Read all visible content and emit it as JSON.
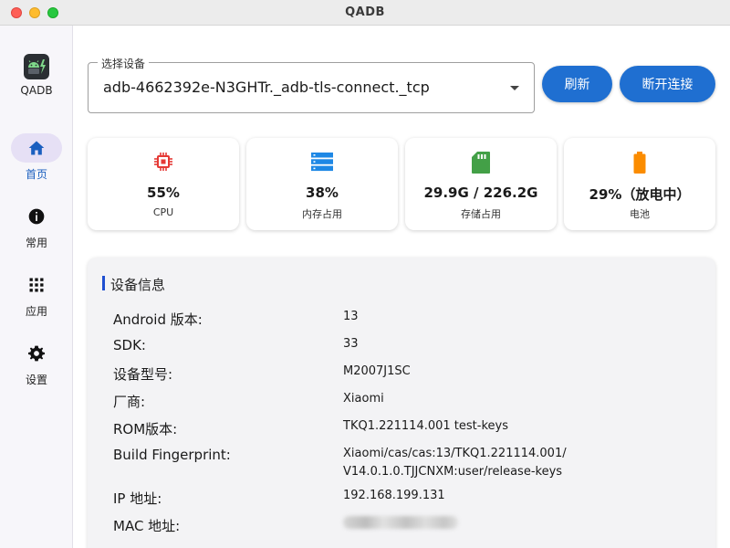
{
  "window": {
    "title": "QADB"
  },
  "sidebar": {
    "logo_text": "QADB",
    "items": [
      {
        "label": "首页",
        "icon": "home-icon",
        "active": true
      },
      {
        "label": "常用",
        "icon": "info-icon",
        "active": false
      },
      {
        "label": "应用",
        "icon": "apps-grid-icon",
        "active": false
      },
      {
        "label": "设置",
        "icon": "gear-icon",
        "active": false
      }
    ]
  },
  "device_selector": {
    "label": "选择设备",
    "value": "adb-4662392e-N3GHTr._adb-tls-connect._tcp"
  },
  "buttons": {
    "refresh": "刷新",
    "disconnect": "断开连接"
  },
  "stats": [
    {
      "icon": "cpu-icon",
      "value": "55%",
      "label": "CPU",
      "color": "#e53935"
    },
    {
      "icon": "storage-stack-icon",
      "value": "38%",
      "label": "内存占用",
      "color": "#1e88e5"
    },
    {
      "icon": "sd-card-icon",
      "value": "29.9G / 226.2G",
      "label": "存储占用",
      "color": "#43a047"
    },
    {
      "icon": "battery-icon",
      "value": "29%（放电中）",
      "label": "电池",
      "color": "#fb8c00"
    }
  ],
  "device_info": {
    "title": "设备信息",
    "rows": [
      {
        "key": "Android 版本:",
        "value": "13"
      },
      {
        "key": "SDK:",
        "value": "33"
      },
      {
        "key": "设备型号:",
        "value": "M2007J1SC"
      },
      {
        "key": "厂商:",
        "value": "Xiaomi"
      },
      {
        "key": "ROM版本:",
        "value": "TKQ1.221114.001 test-keys"
      },
      {
        "key": "Build Fingerprint:",
        "value_line1": "Xiaomi/cas/cas:13/TKQ1.221114.001/",
        "value_line2": "V14.0.1.0.TJJCNXM:user/release-keys"
      },
      {
        "key": "IP 地址:",
        "value": "192.168.199.131"
      },
      {
        "key": "MAC 地址:",
        "value": ""
      }
    ]
  },
  "colors": {
    "accent": "#1f6fd1",
    "active_nav_bg": "#e6e0f5",
    "active_nav_text": "#1b5fbf"
  }
}
